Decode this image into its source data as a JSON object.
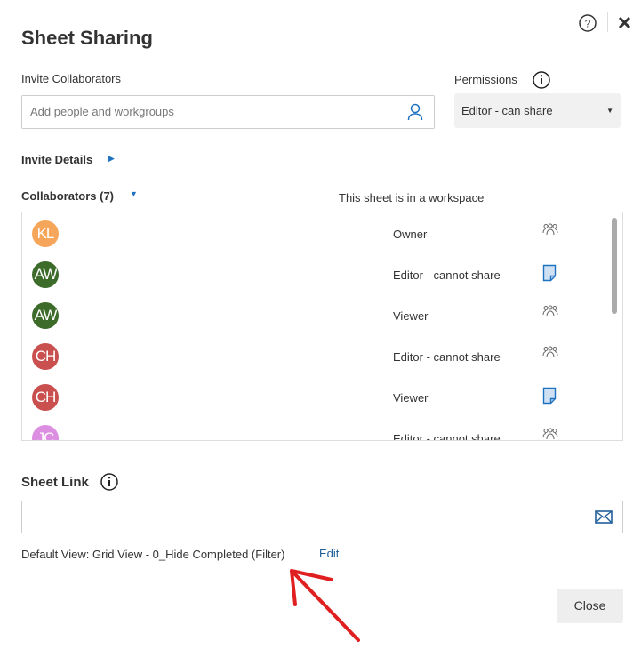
{
  "dialog": {
    "title": "Sheet Sharing",
    "help_icon": "question-circle-icon",
    "close_icon": "x-icon"
  },
  "invite": {
    "label": "Invite Collaborators",
    "placeholder": "Add people and workgroups",
    "icon": "person-icon"
  },
  "permissions": {
    "label": "Permissions",
    "selected": "Editor - can share"
  },
  "invite_details": {
    "label": "Invite Details"
  },
  "collaborators": {
    "label": "Collaborators (7)",
    "workspace_note": "This sheet is in a workspace",
    "items": [
      {
        "initials": "KL",
        "color": "#f5a65b",
        "permission": "Owner",
        "icon": "group-icon"
      },
      {
        "initials": "AW",
        "color": "#3d6b2a",
        "permission": "Editor - cannot share",
        "icon": "sheet-icon"
      },
      {
        "initials": "AW",
        "color": "#3d6b2a",
        "permission": "Viewer",
        "icon": "group-icon"
      },
      {
        "initials": "CH",
        "color": "#c9504f",
        "permission": "Editor - cannot share",
        "icon": "group-icon"
      },
      {
        "initials": "CH",
        "color": "#c9504f",
        "permission": "Viewer",
        "icon": "sheet-icon"
      },
      {
        "initials": "JC",
        "color": "#dc8ee0",
        "permission": "Editor - cannot share",
        "icon": "group-icon"
      }
    ]
  },
  "sheet_link": {
    "label": "Sheet Link",
    "value": "",
    "default_view": "Default View: Grid View - 0_Hide Completed (Filter)",
    "edit": "Edit"
  },
  "footer": {
    "close": "Close"
  },
  "annotation": {
    "color": "#e02020"
  }
}
